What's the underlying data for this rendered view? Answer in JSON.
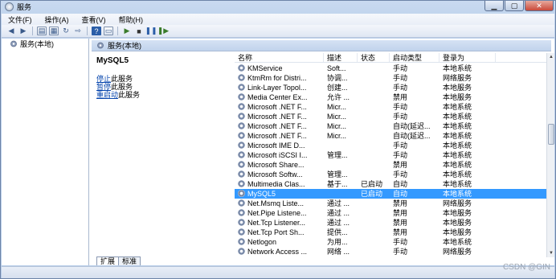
{
  "window": {
    "title": "服务"
  },
  "menu": [
    "文件(F)",
    "操作(A)",
    "查看(V)",
    "帮助(H)"
  ],
  "tree": {
    "root_label": "服务(本地)"
  },
  "pane_header": "服务(本地)",
  "detail": {
    "service_name": "MySQL5",
    "actions": [
      {
        "link": "停止",
        "suffix": "此服务"
      },
      {
        "link": "暂停",
        "suffix": "此服务"
      },
      {
        "link": "重启动",
        "suffix": "此服务"
      }
    ]
  },
  "columns": [
    "名称",
    "描述",
    "状态",
    "启动类型",
    "登录为"
  ],
  "rows": [
    {
      "name": "KMService",
      "desc": "Soft...",
      "status": "",
      "start": "手动",
      "logon": "本地系统"
    },
    {
      "name": "KtmRm for Distri...",
      "desc": "协调...",
      "status": "",
      "start": "手动",
      "logon": "网络服务"
    },
    {
      "name": "Link-Layer Topol...",
      "desc": "创建...",
      "status": "",
      "start": "手动",
      "logon": "本地服务"
    },
    {
      "name": "Media Center Ex...",
      "desc": "允许 ...",
      "status": "",
      "start": "禁用",
      "logon": "本地服务"
    },
    {
      "name": "Microsoft .NET F...",
      "desc": "Micr...",
      "status": "",
      "start": "手动",
      "logon": "本地系统"
    },
    {
      "name": "Microsoft .NET F...",
      "desc": "Micr...",
      "status": "",
      "start": "手动",
      "logon": "本地系统"
    },
    {
      "name": "Microsoft .NET F...",
      "desc": "Micr...",
      "status": "",
      "start": "自动(延迟...",
      "logon": "本地系统"
    },
    {
      "name": "Microsoft .NET F...",
      "desc": "Micr...",
      "status": "",
      "start": "自动(延迟...",
      "logon": "本地系统"
    },
    {
      "name": "Microsoft IME D...",
      "desc": "",
      "status": "",
      "start": "手动",
      "logon": "本地系统"
    },
    {
      "name": "Microsoft iSCSI I...",
      "desc": "管理...",
      "status": "",
      "start": "手动",
      "logon": "本地系统"
    },
    {
      "name": "Microsoft Share...",
      "desc": "",
      "status": "",
      "start": "禁用",
      "logon": "本地系统"
    },
    {
      "name": "Microsoft Softw...",
      "desc": "管理...",
      "status": "",
      "start": "手动",
      "logon": "本地系统"
    },
    {
      "name": "Multimedia Clas...",
      "desc": "基于...",
      "status": "已启动",
      "start": "自动",
      "logon": "本地系统"
    },
    {
      "name": "MySQL5",
      "desc": "",
      "status": "已启动",
      "start": "自动",
      "logon": "本地系统",
      "selected": true
    },
    {
      "name": "Net.Msmq Liste...",
      "desc": "通过 ...",
      "status": "",
      "start": "禁用",
      "logon": "网络服务"
    },
    {
      "name": "Net.Pipe Listene...",
      "desc": "通过 ...",
      "status": "",
      "start": "禁用",
      "logon": "本地服务"
    },
    {
      "name": "Net.Tcp Listener...",
      "desc": "通过 ...",
      "status": "",
      "start": "禁用",
      "logon": "本地服务"
    },
    {
      "name": "Net.Tcp Port Sh...",
      "desc": "提供...",
      "status": "",
      "start": "禁用",
      "logon": "本地服务"
    },
    {
      "name": "Netlogon",
      "desc": "为用...",
      "status": "",
      "start": "手动",
      "logon": "本地系统"
    },
    {
      "name": "Network Access ...",
      "desc": "网络 ...",
      "status": "",
      "start": "手动",
      "logon": "网络服务"
    }
  ],
  "tabs": [
    "扩展",
    "标准"
  ],
  "watermark": "CSDN @GIN"
}
